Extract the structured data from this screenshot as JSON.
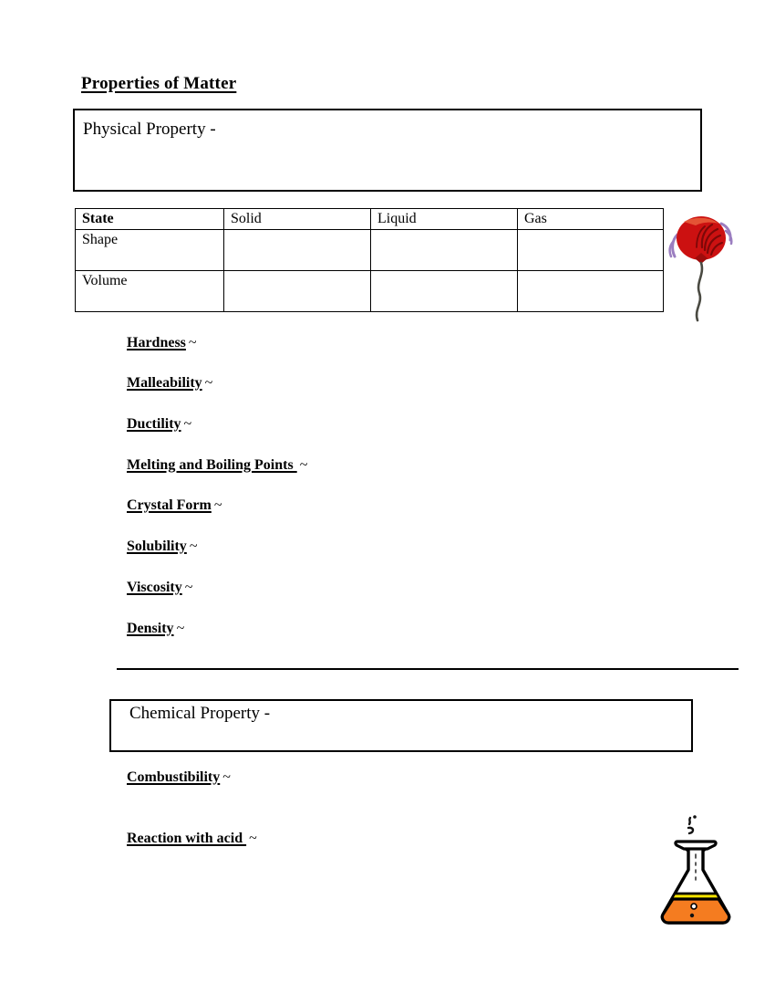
{
  "document": {
    "title": "Properties of Matter"
  },
  "physical_section": {
    "box_label": "Physical Property -",
    "table": {
      "headers": [
        "State",
        "Solid",
        "Liquid",
        "Gas"
      ],
      "rows": [
        {
          "label": "Shape",
          "solid": "",
          "liquid": "",
          "gas": ""
        },
        {
          "label": "Volume",
          "solid": "",
          "liquid": "",
          "gas": ""
        }
      ]
    },
    "terms": [
      {
        "term": "Hardness",
        "marker": "~"
      },
      {
        "term": "Malleability",
        "marker": "~"
      },
      {
        "term": "Ductility",
        "marker": "~"
      },
      {
        "term": "Melting and Boiling Points ",
        "marker": "~"
      },
      {
        "term": "Crystal Form",
        "marker": "~"
      },
      {
        "term": "Solubility",
        "marker": "~"
      },
      {
        "term": "Viscosity",
        "marker": "~"
      },
      {
        "term": "Density",
        "marker": "~"
      }
    ]
  },
  "chemical_section": {
    "box_label": "Chemical Property -",
    "terms": [
      {
        "term": "Combustibility",
        "marker": "~"
      },
      {
        "term": "Reaction with acid ",
        "marker": "~"
      }
    ]
  },
  "clipart": {
    "balloon": {
      "name": "red-balloon",
      "body_color": "#cc1111",
      "shade_color": "#8a0a0a",
      "highlight_color": "#ef5a3a",
      "string_color": "#4a4a42",
      "motion_color": "#9b7ec0"
    },
    "flask": {
      "name": "erlenmeyer-flask",
      "liquid_color": "#f57c20",
      "surface_color": "#f5e400",
      "outline_color": "#000000",
      "glass_color": "#ffffff"
    }
  }
}
